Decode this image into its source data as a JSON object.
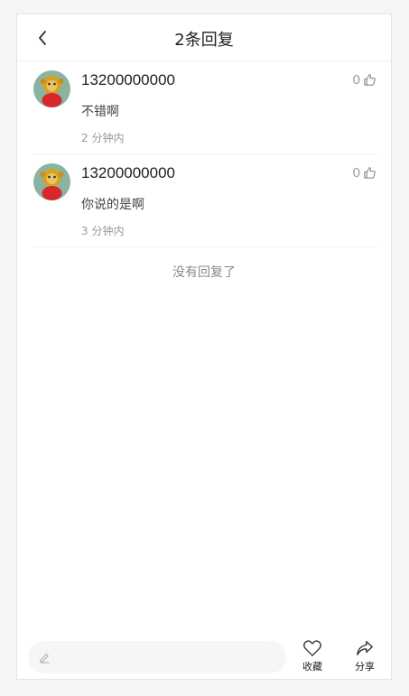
{
  "header": {
    "title": "2条回复"
  },
  "replies": [
    {
      "username": "13200000000",
      "content": "不错啊",
      "time": "2 分钟内",
      "likes": "0"
    },
    {
      "username": "13200000000",
      "content": "你说的是啊",
      "time": "3 分钟内",
      "likes": "0"
    }
  ],
  "end_note": "没有回复了",
  "bottom_bar": {
    "favorite_label": "收藏",
    "share_label": "分享"
  },
  "icons": {
    "back": "chevron-left-icon",
    "like": "thumbs-up-icon",
    "edit": "pencil-icon",
    "favorite": "heart-icon",
    "share": "share-arrow-icon"
  }
}
